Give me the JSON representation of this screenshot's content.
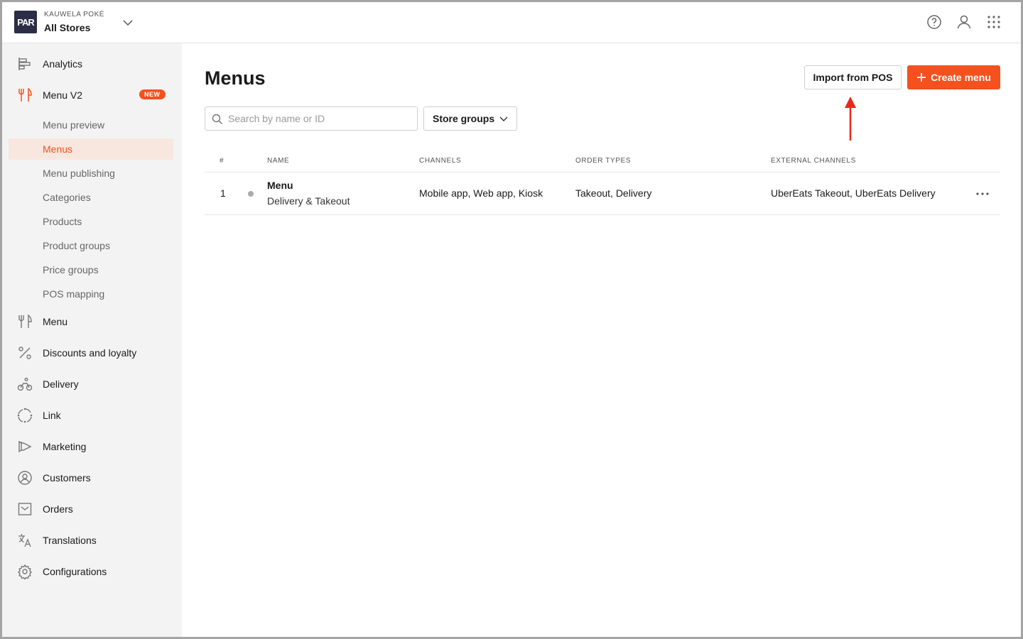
{
  "header": {
    "logo_text": "PAR",
    "org_name": "KAUWELA POKÉ",
    "store_name": "All Stores"
  },
  "sidebar": {
    "items": [
      {
        "label": "Analytics",
        "icon": "analytics-icon"
      },
      {
        "label": "Menu V2",
        "icon": "fork-knife-icon",
        "badge": "NEW"
      },
      {
        "label": "Menu",
        "icon": "fork-knife-icon"
      },
      {
        "label": "Discounts and loyalty",
        "icon": "percent-icon"
      },
      {
        "label": "Delivery",
        "icon": "bike-icon"
      },
      {
        "label": "Link",
        "icon": "link-circle-icon"
      },
      {
        "label": "Marketing",
        "icon": "megaphone-icon"
      },
      {
        "label": "Customers",
        "icon": "customers-icon"
      },
      {
        "label": "Orders",
        "icon": "inbox-icon"
      },
      {
        "label": "Translations",
        "icon": "translate-icon"
      },
      {
        "label": "Configurations",
        "icon": "gear-icon"
      }
    ],
    "sub_items": [
      {
        "label": "Menu preview"
      },
      {
        "label": "Menus",
        "active": true
      },
      {
        "label": "Menu publishing"
      },
      {
        "label": "Categories"
      },
      {
        "label": "Products"
      },
      {
        "label": "Product groups"
      },
      {
        "label": "Price groups"
      },
      {
        "label": "POS mapping"
      }
    ]
  },
  "main": {
    "title": "Menus",
    "import_button": "Import from POS",
    "create_button": "Create menu",
    "search_placeholder": "Search by name or ID",
    "store_groups_label": "Store groups",
    "table": {
      "columns": [
        "#",
        "NAME",
        "CHANNELS",
        "ORDER TYPES",
        "EXTERNAL CHANNELS"
      ],
      "rows": [
        {
          "index": "1",
          "name": "Menu",
          "subtitle": "Delivery & Takeout",
          "channels": "Mobile app, Web app, Kiosk",
          "order_types": "Takeout, Delivery",
          "external_channels": "UberEats Takeout, UberEats Delivery"
        }
      ]
    }
  },
  "colors": {
    "accent": "#f4511e",
    "sidebar_bg": "#f3f3f3",
    "active_bg": "#f8e7df",
    "logo_bg": "#2b2e44",
    "annotation_arrow": "#e8281b"
  }
}
